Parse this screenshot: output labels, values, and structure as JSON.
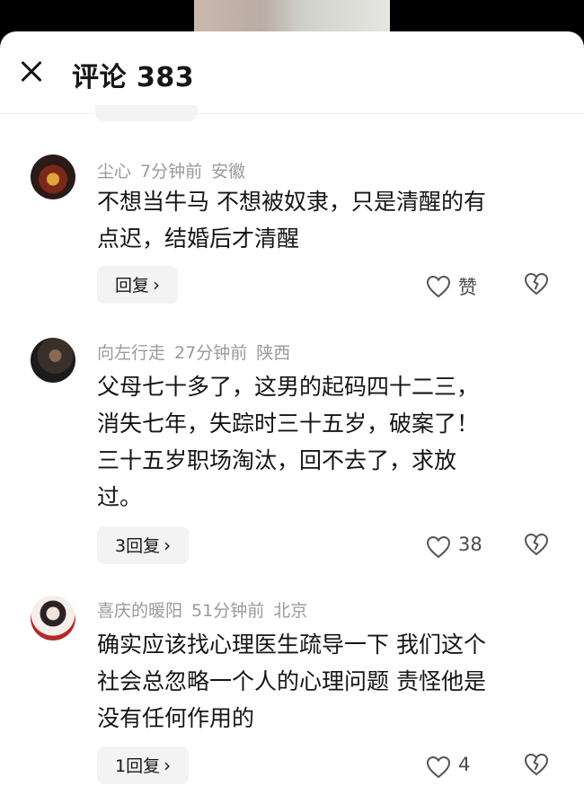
{
  "header": {
    "title": "评论 383"
  },
  "comments": [
    {
      "user": "尘心",
      "time": "7分钟前",
      "location": "安徽",
      "text_lines": [
        "不想当牛马 不想被奴隶，只是清醒的有",
        "点迟，结婚后才清醒"
      ],
      "reply_label": "回复",
      "likes": "赞"
    },
    {
      "user": "向左行走",
      "time": "27分钟前",
      "location": "陕西",
      "text_lines": [
        "父母七十多了，这男的起码四十二三，",
        "消失七年，失踪时三十五岁，破案了！",
        "三十五岁职场淘汰，回不去了，求放",
        "过。"
      ],
      "reply_label": "3回复",
      "likes": "38"
    },
    {
      "user": "喜庆的暖阳",
      "time": "51分钟前",
      "location": "北京",
      "text_lines": [
        "确实应该找心理医生疏导一下 我们这个",
        "社会总忽略一个人的心理问题 责怪他是",
        "没有任何作用的"
      ],
      "reply_label": "1回复",
      "likes": "4"
    }
  ]
}
